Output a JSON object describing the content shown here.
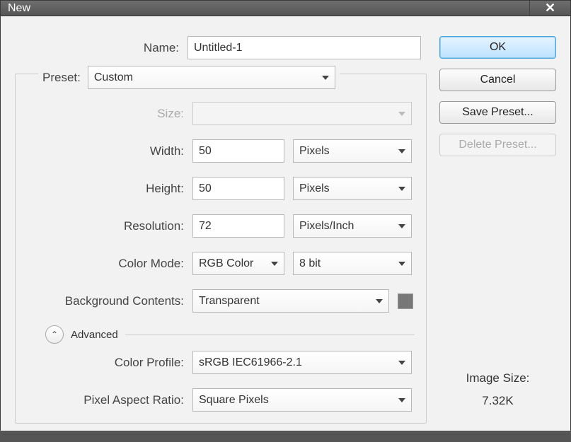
{
  "window": {
    "title": "New"
  },
  "name": {
    "label": "Name:",
    "value": "Untitled-1"
  },
  "preset": {
    "label": "Preset:",
    "value": "Custom"
  },
  "size": {
    "label": "Size:",
    "value": ""
  },
  "width": {
    "label": "Width:",
    "value": "50",
    "unit": "Pixels"
  },
  "height": {
    "label": "Height:",
    "value": "50",
    "unit": "Pixels"
  },
  "resolution": {
    "label": "Resolution:",
    "value": "72",
    "unit": "Pixels/Inch"
  },
  "color_mode": {
    "label": "Color Mode:",
    "value": "RGB Color",
    "depth": "8 bit"
  },
  "background": {
    "label": "Background Contents:",
    "value": "Transparent"
  },
  "advanced": {
    "label": "Advanced"
  },
  "color_profile": {
    "label": "Color Profile:",
    "value": "sRGB IEC61966-2.1"
  },
  "pixel_aspect": {
    "label": "Pixel Aspect Ratio:",
    "value": "Square Pixels"
  },
  "buttons": {
    "ok": "OK",
    "cancel": "Cancel",
    "save_preset": "Save Preset...",
    "delete_preset": "Delete Preset..."
  },
  "image_size": {
    "label": "Image Size:",
    "value": "7.32K"
  }
}
